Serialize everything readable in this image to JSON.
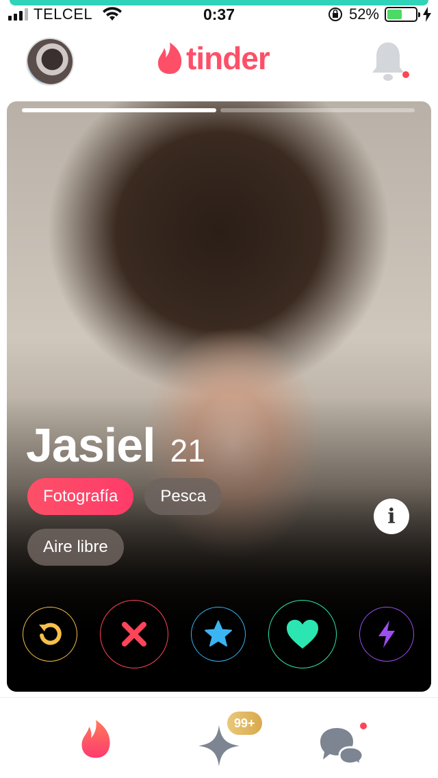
{
  "status_bar": {
    "carrier": "TELCEL",
    "time": "0:37",
    "battery_percent": "52%",
    "battery_level": 0.52,
    "signal_bars": 4
  },
  "header": {
    "logo_text": "tinder",
    "brand_color": "#fd5068",
    "notifications_unread": true
  },
  "profile": {
    "name": "Jasiel",
    "age": "21",
    "photo_count": 2,
    "active_photo": 1,
    "info_label": "i",
    "interests": [
      {
        "label": "Fotografía",
        "shared": true
      },
      {
        "label": "Pesca",
        "shared": false
      },
      {
        "label": "Aire libre",
        "shared": false
      }
    ]
  },
  "actions": [
    {
      "name": "rewind",
      "icon": "rewind-icon",
      "color": "#f7c04a"
    },
    {
      "name": "nope",
      "icon": "close-icon",
      "color": "#ff4458"
    },
    {
      "name": "super-like",
      "icon": "star-icon",
      "color": "#3ab4f2"
    },
    {
      "name": "like",
      "icon": "heart-icon",
      "color": "#2ce6b2"
    },
    {
      "name": "boost",
      "icon": "bolt-icon",
      "color": "#9d4ef0"
    }
  ],
  "bottom_nav": {
    "items": [
      {
        "name": "discover",
        "icon": "flame-icon",
        "active": true
      },
      {
        "name": "top-picks",
        "icon": "sparkle-icon",
        "badge": "99+"
      },
      {
        "name": "messages",
        "icon": "chat-icon",
        "unread": true
      }
    ]
  }
}
